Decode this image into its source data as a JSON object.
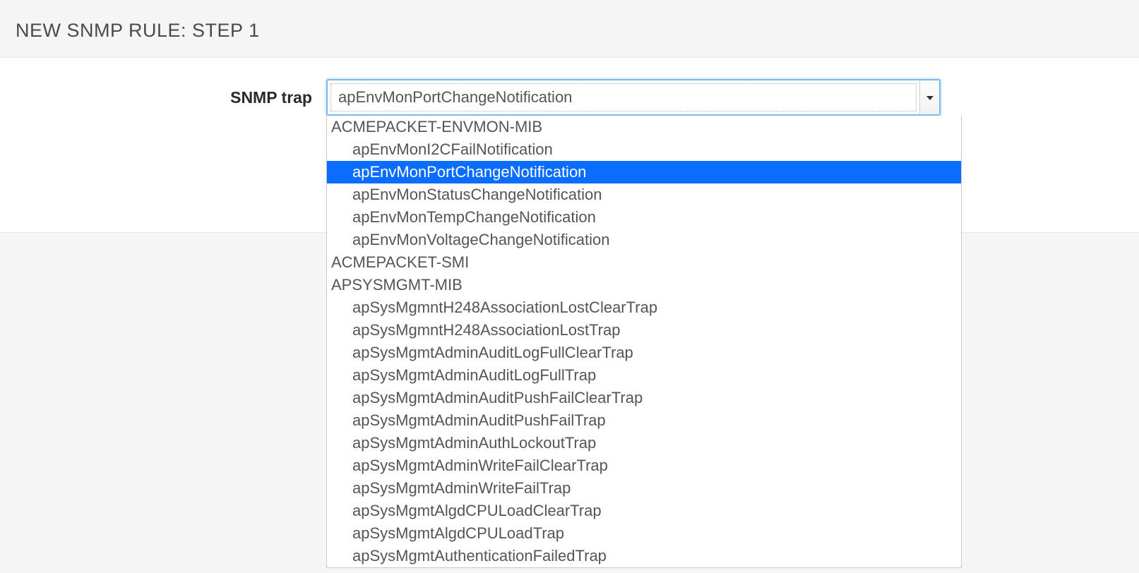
{
  "header": {
    "title": "NEW SNMP RULE: STEP 1"
  },
  "form": {
    "snmp_trap_label": "SNMP trap",
    "snmp_trap_value": "apEnvMonPortChangeNotification",
    "selected_item": "apEnvMonPortChangeNotification"
  },
  "dropdown": {
    "groups": [
      {
        "label": "ACMEPACKET-ENVMON-MIB",
        "items": [
          "apEnvMonI2CFailNotification",
          "apEnvMonPortChangeNotification",
          "apEnvMonStatusChangeNotification",
          "apEnvMonTempChangeNotification",
          "apEnvMonVoltageChangeNotification"
        ]
      },
      {
        "label": "ACMEPACKET-SMI",
        "items": []
      },
      {
        "label": "APSYSMGMT-MIB",
        "items": [
          "apSysMgmntH248AssociationLostClearTrap",
          "apSysMgmntH248AssociationLostTrap",
          "apSysMgmtAdminAuditLogFullClearTrap",
          "apSysMgmtAdminAuditLogFullTrap",
          "apSysMgmtAdminAuditPushFailClearTrap",
          "apSysMgmtAdminAuditPushFailTrap",
          "apSysMgmtAdminAuthLockoutTrap",
          "apSysMgmtAdminWriteFailClearTrap",
          "apSysMgmtAdminWriteFailTrap",
          "apSysMgmtAlgdCPULoadClearTrap",
          "apSysMgmtAlgdCPULoadTrap",
          "apSysMgmtAuthenticationFailedTrap"
        ]
      }
    ]
  }
}
